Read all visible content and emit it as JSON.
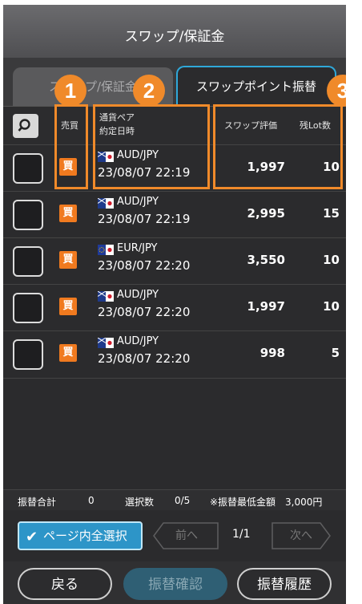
{
  "title": "スワップ/保証金",
  "tabs": [
    {
      "label": "スワップ/保証金"
    },
    {
      "label": "スワップポイント振替"
    }
  ],
  "header": {
    "side": "売買",
    "pair_line1": "通貨ペア",
    "pair_line2": "約定日時",
    "valuation": "スワップ評価",
    "lots": "残Lot数"
  },
  "callouts": [
    "1",
    "2",
    "3"
  ],
  "rows": [
    {
      "side": "買",
      "pair": "AUD/JPY",
      "flag": "aud-jpy-flag-icon",
      "datetime": "23/08/07 22:19",
      "valuation": "1,997",
      "lots": "10"
    },
    {
      "side": "買",
      "pair": "AUD/JPY",
      "flag": "aud-jpy-flag-icon",
      "datetime": "23/08/07 22:19",
      "valuation": "2,995",
      "lots": "15"
    },
    {
      "side": "買",
      "pair": "EUR/JPY",
      "flag": "eur-jpy-flag-icon",
      "datetime": "23/08/07 22:20",
      "valuation": "3,550",
      "lots": "10"
    },
    {
      "side": "買",
      "pair": "AUD/JPY",
      "flag": "aud-jpy-flag-icon",
      "datetime": "23/08/07 22:20",
      "valuation": "1,997",
      "lots": "10"
    },
    {
      "side": "買",
      "pair": "AUD/JPY",
      "flag": "aud-jpy-flag-icon",
      "datetime": "23/08/07 22:20",
      "valuation": "998",
      "lots": "5"
    }
  ],
  "summary": {
    "total_label": "振替合計",
    "total_value": "0",
    "selected_label": "選択数",
    "selected_value": "0/5",
    "min_label": "※振替最低金額",
    "min_value": "3,000円"
  },
  "pager": {
    "select_all": "ページ内全選択",
    "prev": "前へ",
    "page": "1/1",
    "next": "次へ"
  },
  "buttons": {
    "back": "戻る",
    "confirm": "振替確認",
    "history": "振替履歴"
  },
  "colors": {
    "accent_orange": "#f08a2a",
    "badge_orange": "#f07a1f",
    "tab_blue": "#2fa8d9",
    "select_blue": "#2d95c8"
  }
}
